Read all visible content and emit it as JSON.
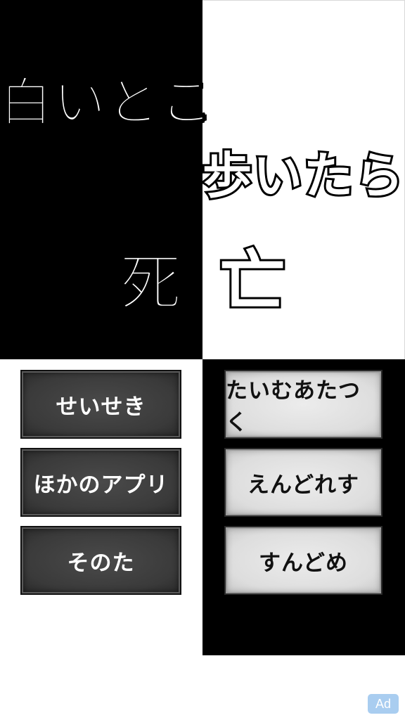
{
  "title": {
    "line1": "白いとこ",
    "line2": "歩いたら",
    "line3a": "死",
    "line3b": "亡"
  },
  "menu_left": {
    "items": [
      {
        "label": "せいせき"
      },
      {
        "label": "ほかのアプリ"
      },
      {
        "label": "そのた"
      }
    ]
  },
  "menu_right": {
    "items": [
      {
        "label": "たいむあたつく"
      },
      {
        "label": "えんどれす"
      },
      {
        "label": "すんどめ"
      }
    ]
  },
  "ad": {
    "label": "Ad"
  },
  "colors": {
    "banner_left": "#000000",
    "banner_right": "#ffffff",
    "ad_badge": "#a9cdf0"
  }
}
